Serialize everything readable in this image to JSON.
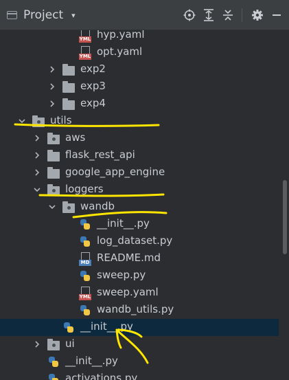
{
  "toolbar": {
    "title": "Project",
    "caret": "▾",
    "buttons": [
      "target-icon",
      "expand-all-icon",
      "collapse-all-icon",
      "settings-icon",
      "minimize-icon"
    ]
  },
  "tree": {
    "rows": [
      {
        "label": "hyp.yaml",
        "kind": "yaml"
      },
      {
        "label": "opt.yaml",
        "kind": "yaml"
      },
      {
        "label": "exp2",
        "kind": "folder",
        "expanded": false
      },
      {
        "label": "exp3",
        "kind": "folder",
        "expanded": false
      },
      {
        "label": "exp4",
        "kind": "folder",
        "expanded": false
      },
      {
        "label": "utils",
        "kind": "package",
        "expanded": true
      },
      {
        "label": "aws",
        "kind": "package",
        "expanded": false
      },
      {
        "label": "flask_rest_api",
        "kind": "folder",
        "expanded": false
      },
      {
        "label": "google_app_engine",
        "kind": "folder",
        "expanded": false
      },
      {
        "label": "loggers",
        "kind": "package",
        "expanded": true
      },
      {
        "label": "wandb",
        "kind": "package",
        "expanded": true
      },
      {
        "label": "__init__.py",
        "kind": "python"
      },
      {
        "label": "log_dataset.py",
        "kind": "python"
      },
      {
        "label": "README.md",
        "kind": "markdown"
      },
      {
        "label": "sweep.py",
        "kind": "python"
      },
      {
        "label": "sweep.yaml",
        "kind": "yaml"
      },
      {
        "label": "wandb_utils.py",
        "kind": "python"
      },
      {
        "label": "__init__.py",
        "kind": "python",
        "selected": true
      },
      {
        "label": "ui",
        "kind": "package",
        "expanded": false
      },
      {
        "label": "__init__.py",
        "kind": "python"
      },
      {
        "label": "activations.py",
        "kind": "python"
      }
    ]
  },
  "badges": {
    "yaml": "YML",
    "markdown": "MD"
  },
  "colors": {
    "background": "#2b2d30",
    "selected_row": "#0d293e",
    "annotation": "#ffe600"
  }
}
